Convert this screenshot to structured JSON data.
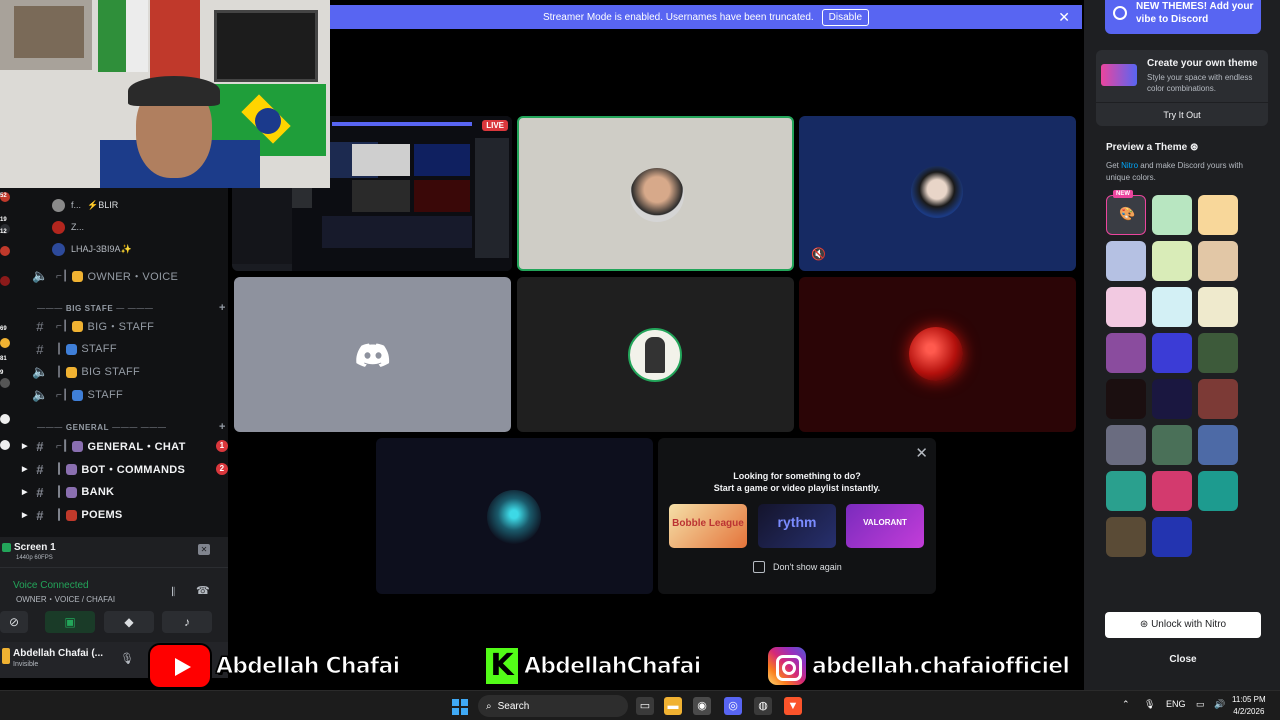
{
  "streamer_bar": {
    "message": "Streamer Mode is enabled. Usernames have been truncated.",
    "disable_label": "Disable",
    "close_icon": "close-icon"
  },
  "voice_users": [
    {
      "name": "f...",
      "suffix": "⚡BLIR",
      "color": "#8a8a8a"
    },
    {
      "name": "Z...",
      "suffix": "",
      "color": "#b3261e"
    },
    {
      "name": "LHAJ-3BI9A✨",
      "suffix": "",
      "color": "#2d4a9b"
    }
  ],
  "channels": [
    {
      "type": "voice",
      "label": "OWNER・VOICE",
      "emoji_color": "#f0b232",
      "bold": false
    },
    {
      "type": "category",
      "label": "BIG STAFE"
    },
    {
      "type": "text",
      "label": "BIG・STAFF",
      "emoji_color": "#f0b232",
      "bold": false
    },
    {
      "type": "text",
      "label": "STAFF",
      "emoji_color": "#3f7fd8",
      "bold": false
    },
    {
      "type": "voice",
      "label": "BIG STAFF",
      "emoji_color": "#f0b232",
      "bold": false
    },
    {
      "type": "voice",
      "label": "STAFF",
      "emoji_color": "#3f7fd8",
      "bold": false
    },
    {
      "type": "category",
      "label": "GENERAL"
    },
    {
      "type": "text",
      "label": "GENERAL・CHAT",
      "emoji_color": "#8a6fb0",
      "bold": true,
      "badge": "1"
    },
    {
      "type": "text",
      "label": "BOT・COMMANDS",
      "emoji_color": "#8a6fb0",
      "bold": true,
      "badge": "2"
    },
    {
      "type": "text",
      "label": "BANK",
      "emoji_color": "#8a6fb0",
      "bold": true
    },
    {
      "type": "text",
      "label": "POEMS",
      "emoji_color": "#c0392b",
      "bold": true
    }
  ],
  "server_badges": [
    "52",
    "19",
    "12",
    "69",
    "81",
    "9"
  ],
  "screen_share": {
    "title": "Screen 1",
    "subtitle": "1440p 60FPS",
    "close_icon": "close-icon"
  },
  "voice_status": {
    "label": "Voice Connected",
    "channel": "OWNER・VOICE / CHAFAI"
  },
  "user": {
    "name": "Abdellah Chafai (...",
    "status": "Invisible"
  },
  "stage": {
    "live_label": "LIVE"
  },
  "activity": {
    "title_line1": "Looking for something to do?",
    "title_line2": "Start a game or video playlist instantly.",
    "cards": [
      {
        "label": "Bobble League",
        "color1": "#f5e0a8",
        "color2": "#e4733a"
      },
      {
        "label": "rythm",
        "color1": "#14142c",
        "color2": "#5865f2"
      },
      {
        "label": "VALORANT",
        "color1": "#7a2bbd",
        "color2": "#c33dd9"
      }
    ],
    "dont_show": "Don't show again"
  },
  "theme_panel": {
    "promo": "NEW THEMES! Add your vibe to Discord",
    "create_title": "Create your own theme",
    "create_desc": "Style your space with endless color combinations.",
    "try_label": "Try It Out",
    "preview_title": "Preview a Theme",
    "preview_desc_before": "Get ",
    "preview_desc_link": "Nitro",
    "preview_desc_after": " and make Discord yours with unique colors.",
    "new_badge": "NEW",
    "unlock_label": "Unlock with Nitro",
    "close_label": "Close",
    "swatches": [
      [
        "#3a3d44",
        "#b8e6c1",
        "#f8d79a"
      ],
      [
        "#b5c1e3",
        "#d9ecb8",
        "#e2c7a6"
      ],
      [
        "#f2c9e1",
        "#d3f0f5",
        "#efeacd"
      ],
      [
        "#8a4c9e",
        "#3b3cd6",
        "#3d5a3a"
      ],
      [
        "#1b0f10",
        "#1a1740",
        "#7c3a36"
      ],
      [
        "#6a6c80",
        "#4a7058",
        "#4d6aa6"
      ],
      [
        "#2aa08e",
        "#d33a6e",
        "#1d9b8f"
      ],
      [
        "#5a4b36",
        "#2334b0",
        null
      ]
    ]
  },
  "social": {
    "youtube": "Abdellah Chafai",
    "kick": "AbdellahChafai",
    "instagram": "abdellah.chafaiofficiel"
  },
  "taskbar": {
    "search": "Search",
    "lang": "ENG",
    "time": "11:05 PM",
    "date": "4/2/2026"
  }
}
